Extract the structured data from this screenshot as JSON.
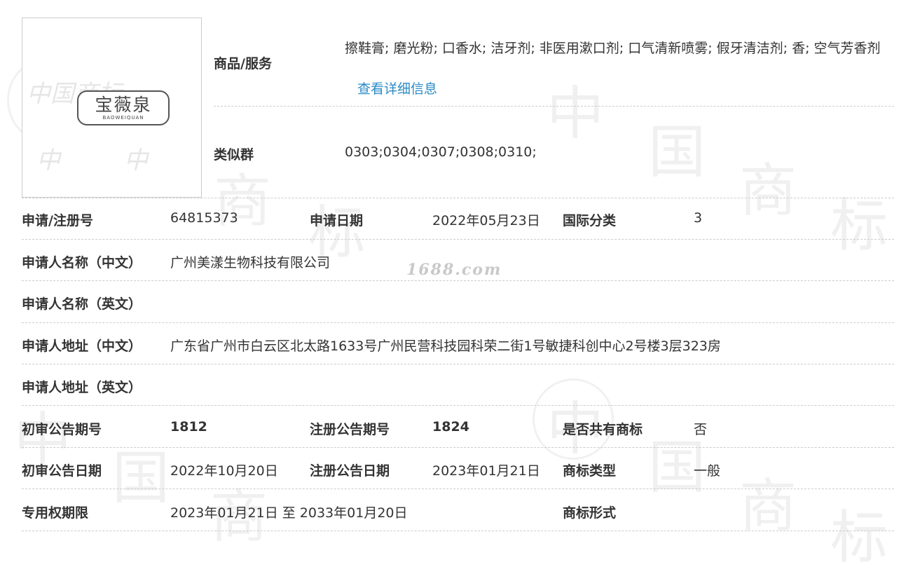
{
  "logo": {
    "name_cn": "宝薇泉",
    "name_en": "BAOWEIQUAN"
  },
  "goods": {
    "label": "商品/服务",
    "value": "擦鞋膏; 磨光粉; 口香水; 洁牙剂; 非医用漱口剂; 口气清新喷雾; 假牙清洁剂; 香; 空气芳香剂",
    "detail_link": "查看详细信息"
  },
  "similar_group": {
    "label": "类似群",
    "value": "0303;0304;0307;0308;0310;"
  },
  "rows": {
    "reg_no": {
      "label": "申请/注册号",
      "value": "64815373"
    },
    "apply_date": {
      "label": "申请日期",
      "value": "2022年05月23日"
    },
    "intl_class": {
      "label": "国际分类",
      "value": "3"
    },
    "applicant_cn": {
      "label": "申请人名称（中文）",
      "value": "广州美漾生物科技有限公司"
    },
    "applicant_en": {
      "label": "申请人名称（英文）",
      "value": ""
    },
    "address_cn": {
      "label": "申请人地址（中文）",
      "value": "广东省广州市白云区北太路1633号广州民营科技园科荣二街1号敏捷科创中心2号楼3层323房"
    },
    "address_en": {
      "label": "申请人地址（英文）",
      "value": ""
    },
    "prelim_issue": {
      "label": "初审公告期号",
      "value": "1812"
    },
    "reg_issue": {
      "label": "注册公告期号",
      "value": "1824"
    },
    "shared": {
      "label": "是否共有商标",
      "value": "否"
    },
    "prelim_date": {
      "label": "初审公告日期",
      "value": "2022年10月20日"
    },
    "reg_date": {
      "label": "注册公告日期",
      "value": "2023年01月21日"
    },
    "mark_type": {
      "label": "商标类型",
      "value": "一般"
    },
    "exclusive_period": {
      "label": "专用权期限",
      "value": "2023年01月21日 至 2033年01月20日"
    },
    "mark_form": {
      "label": "商标形式",
      "value": ""
    }
  },
  "watermark": {
    "site": "1688.com"
  },
  "colors": {
    "link": "#2a8bc6",
    "text": "#333333",
    "divider": "#cccccc"
  }
}
